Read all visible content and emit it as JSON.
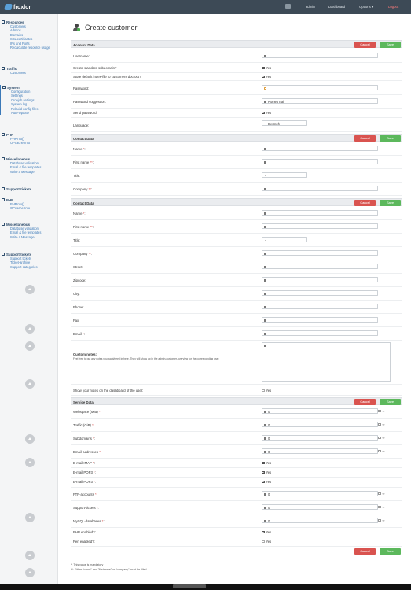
{
  "header": {
    "brand": "froxlor",
    "user": "admin",
    "dashboard": "Dashboard",
    "options": "Options ▾",
    "logout": "Logout"
  },
  "sidebar": {
    "groups": [
      {
        "title": "Resources",
        "items": [
          "Customers",
          "Admins",
          "Domains",
          "SSL certificates",
          "IPs and Ports",
          "Recalculate resource usage"
        ]
      },
      {
        "title": "Traffic",
        "items": [
          "Customers"
        ]
      },
      {
        "title": "System",
        "items": [
          "Configuration",
          "Settings",
          "Cronjob settings",
          "System log",
          "Rebuild config files",
          "Auto-Update"
        ]
      },
      {
        "title": "PHP",
        "items": [
          "PHPinfo()",
          "OPcache-Info"
        ]
      },
      {
        "title": "Miscellaneous",
        "items": [
          "Database validation",
          "Email & file templates",
          "Write a Message"
        ]
      },
      {
        "title": "Support-tickets",
        "items": []
      },
      {
        "title": "PHP",
        "items": [
          "PHPinfo()",
          "OPcache-Info"
        ]
      },
      {
        "title": "Miscellaneous",
        "items": [
          "Database validation",
          "Email & file templates",
          "Write a Message"
        ]
      },
      {
        "title": "Support-tickets",
        "items": [
          "Support tickets",
          "Ticket-archive",
          "Support-categories"
        ]
      }
    ]
  },
  "page": {
    "title": "Create customer",
    "cancel": "Cancel",
    "save": "Save"
  },
  "account": {
    "title": "Account Data",
    "username": "Username:",
    "std_subdomain": "Create standard subdomain?",
    "store_index": "Store default index-file to customers docroot?",
    "password": "Password:",
    "password_suggestion": "Password suggestion:",
    "password_suggestion_value": "RomeoTrail",
    "send_password": "Send password:",
    "language": "Language:",
    "language_value": "Deutsch",
    "yes": "Yes"
  },
  "contact1": {
    "title": "Contact Data",
    "name": "Name",
    "first_name": "First name",
    "title_label": "Title:",
    "company": "Company",
    "title_value": "-"
  },
  "contact2": {
    "title": "Contact Data",
    "name": "Name",
    "first_name": "First name",
    "title_label": "Title:",
    "company": "Company",
    "street": "Street:",
    "zipcode": "Zipcode:",
    "city": "City:",
    "phone": "Phone:",
    "fax": "Fax:",
    "email": "Email",
    "custom_notes": "Custom notes:",
    "custom_notes_hint": "Feel free to put any notes you want/need in here. They will show up in the admin-customer-overview for the corresponding user.",
    "show_notes": "Show your notes on the dashboard of the user:",
    "title_value": "-"
  },
  "service": {
    "title": "Service Data",
    "webspace": "Webspace (MiB)",
    "traffic": "Traffic (GiB)",
    "subdomains": "Subdomains",
    "email_addresses": "Email-addresses",
    "imap": "E-mail IMAP",
    "pop3": "E-mail POP3",
    "pop3b": "E-mail POP3",
    "ftp": "FTP-accounts",
    "tickets": "Support-tickets",
    "mysql": "MySQL-databases",
    "php": "PHP enabled?",
    "perl": "Perl enabled?",
    "zero": "0",
    "inf": "∞"
  },
  "footer": {
    "mandatory": "*: This value is mandatory",
    "either": "**: Either \"name\" and \"firstname\" or \"company\" must be filled"
  }
}
